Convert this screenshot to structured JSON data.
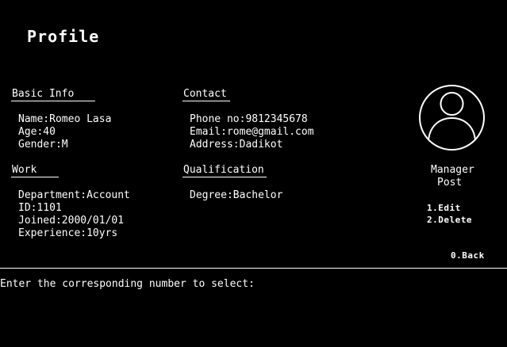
{
  "page": {
    "title": "Profile"
  },
  "basic_info": {
    "heading": "Basic Info",
    "name": "Name:Romeo Lasa",
    "age": "Age:40",
    "gender": "Gender:M"
  },
  "contact": {
    "heading": "Contact",
    "phone": "Phone no:9812345678",
    "email": "Email:rome@gmail.com",
    "address": "Address:Dadikot"
  },
  "work": {
    "heading": "Work",
    "department": "Department:Account",
    "id": "ID:1101",
    "joined": "Joined:2000/01/01",
    "experience": "Experience:10yrs"
  },
  "qualification": {
    "heading": "Qualification",
    "degree": "Degree:Bachelor"
  },
  "profile_card": {
    "avatar_icon": "user-avatar-icon",
    "role_line1": "Manager",
    "role_line2": "Post"
  },
  "menu": {
    "edit": "1.Edit",
    "delete": "2.Delete",
    "back": "0.Back"
  },
  "prompt": {
    "text": "Enter the corresponding number to select:"
  },
  "colors": {
    "background": "#000000",
    "foreground": "#ffffff"
  }
}
